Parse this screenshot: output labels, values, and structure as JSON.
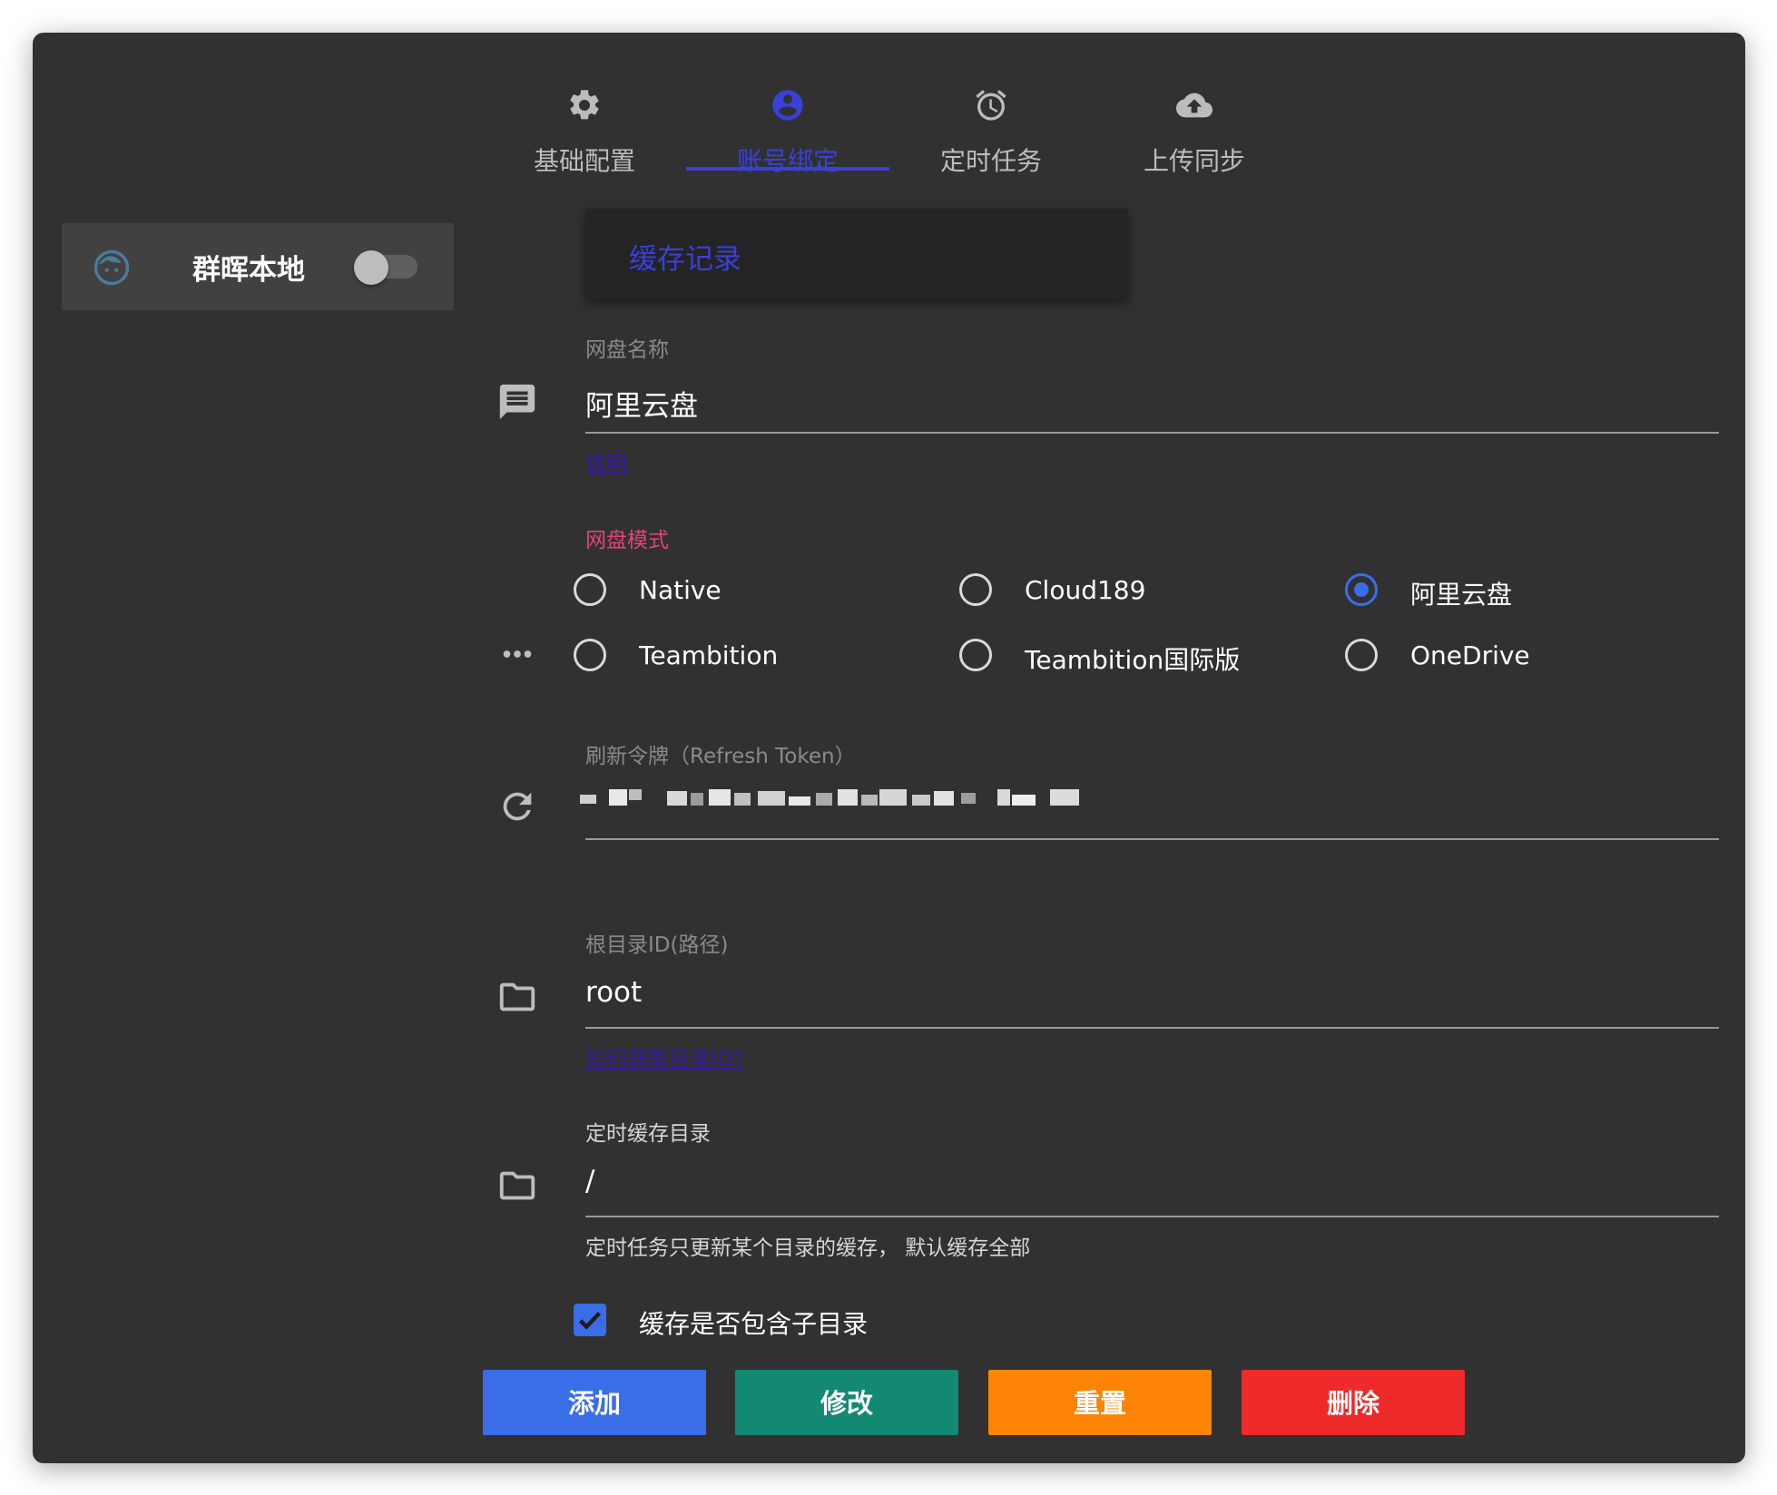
{
  "tabs": [
    {
      "label": "基础配置",
      "icon": "gear-icon",
      "active": false
    },
    {
      "label": "账号绑定",
      "icon": "account-circle-icon",
      "active": true
    },
    {
      "label": "定时任务",
      "icon": "alarm-clock-icon",
      "active": false
    },
    {
      "label": "上传同步",
      "icon": "cloud-upload-icon",
      "active": false
    }
  ],
  "sidebar": {
    "account": {
      "name": "群晖本地",
      "avatar": "face-icon",
      "enabled": false
    }
  },
  "form": {
    "cache_card_label": "缓存记录",
    "drive_name": {
      "label": "网盘名称",
      "value": "阿里云盘",
      "help_link": "说明",
      "icon": "message-icon"
    },
    "drive_mode": {
      "label": "网盘模式",
      "icon": "more-dots-icon",
      "options": [
        "Native",
        "Cloud189",
        "阿里云盘",
        "Teambition",
        "Teambition国际版",
        "OneDrive"
      ],
      "selected": "阿里云盘"
    },
    "refresh_token": {
      "label": "刷新令牌（Refresh Token）",
      "icon": "refresh-icon",
      "value_redacted": true
    },
    "root_dir": {
      "label": "根目录ID(路径)",
      "value": "root",
      "help_link": "如何获取目录ID?",
      "icon": "folder-icon"
    },
    "cache_dir": {
      "label": "定时缓存目录",
      "value": "/",
      "hint": "定时任务只更新某个目录的缓存， 默认缓存全部",
      "icon": "folder-icon"
    },
    "include_subdirs": {
      "label": "缓存是否包含子目录",
      "checked": true
    }
  },
  "buttons": {
    "add": "添加",
    "edit": "修改",
    "reset": "重置",
    "delete": "删除"
  },
  "colors": {
    "accent": "#3a40d8",
    "primary_blue": "#3a6ee8",
    "teal": "#138873",
    "orange": "#fd8404",
    "red": "#ee2a2a",
    "pink_label": "#e0447a"
  }
}
